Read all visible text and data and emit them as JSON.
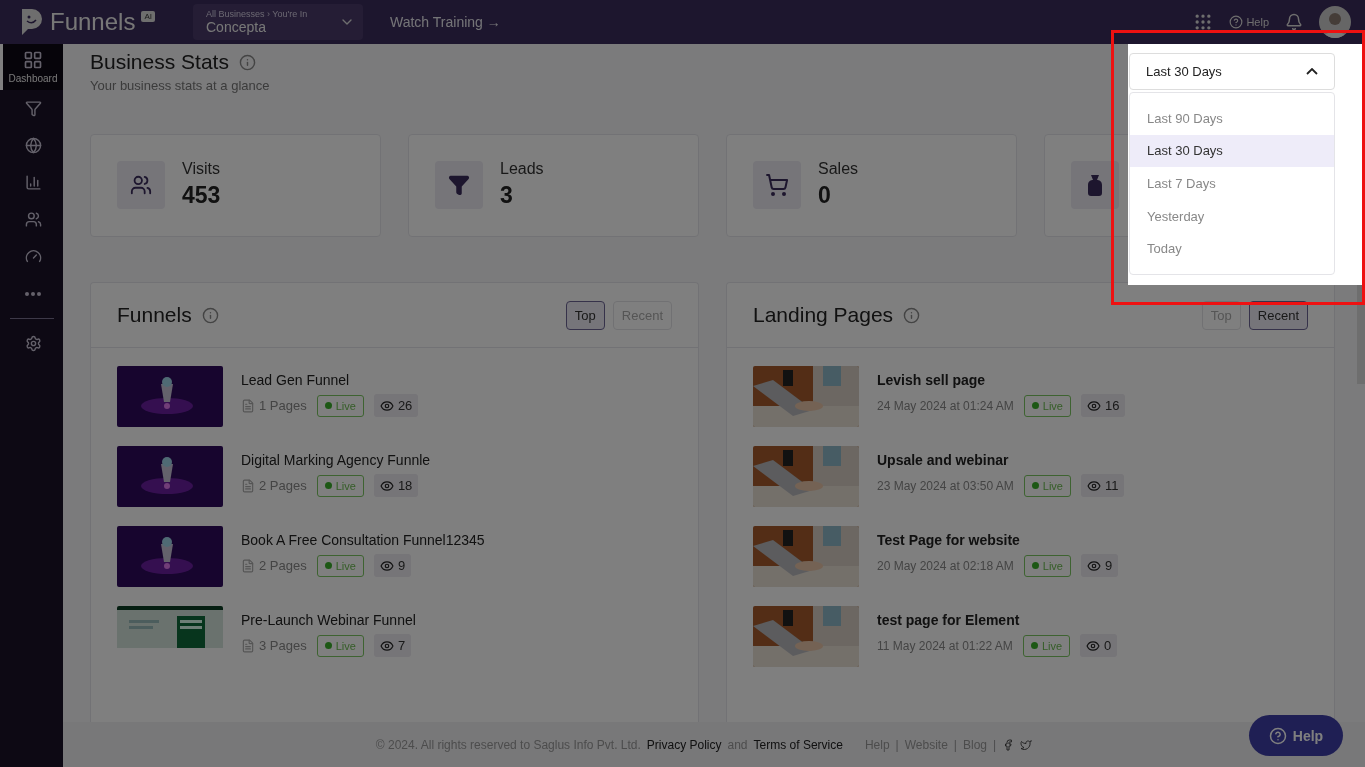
{
  "topbar": {
    "logo": "Funnels",
    "logo_badge": "AI",
    "business_label": "All Businesses › You're In",
    "business": "Concepta",
    "training_link": "Watch Training →",
    "help": "Help"
  },
  "sidebar": {
    "items": [
      {
        "kind": "dashboard",
        "label": "Dashboard",
        "selected": true
      },
      {
        "kind": "funnels",
        "selected": false
      },
      {
        "kind": "websites",
        "selected": false
      },
      {
        "kind": "analytics",
        "selected": false
      },
      {
        "kind": "contacts",
        "selected": false
      },
      {
        "kind": "performance",
        "selected": false
      },
      {
        "kind": "more",
        "selected": false
      },
      {
        "kind": "settings",
        "selected": false
      }
    ]
  },
  "header": {
    "title": "Business Stats",
    "subtitle": "Your business stats at a glance"
  },
  "stats": [
    {
      "kind": "visits",
      "label": "Visits",
      "value": "453"
    },
    {
      "kind": "leads",
      "label": "Leads",
      "value": "3"
    },
    {
      "kind": "sales",
      "label": "Sales",
      "value": "0"
    },
    {
      "kind": "revenue"
    }
  ],
  "funnels": {
    "title": "Funnels",
    "tabs": [
      {
        "label": "Top",
        "selected": true
      },
      {
        "label": "Recent",
        "selected": false
      }
    ],
    "items": [
      {
        "kind": "funnel",
        "name": "Lead Gen Funnel",
        "pages": "1 Pages",
        "status": "Live",
        "views": "26"
      },
      {
        "kind": "funnel",
        "name": "Digital Marking Agency Funnle",
        "pages": "2 Pages",
        "status": "Live",
        "views": "18"
      },
      {
        "kind": "funnel",
        "name": "Book A Free Consultation Funnel12345",
        "pages": "2 Pages",
        "status": "Live",
        "views": "9"
      },
      {
        "kind": "webpage",
        "name": "Pre-Launch Webinar Funnel",
        "pages": "3 Pages",
        "status": "Live",
        "views": "7"
      }
    ]
  },
  "landing_pages": {
    "title": "Landing Pages",
    "tabs": [
      {
        "label": "Top",
        "selected": false
      },
      {
        "label": "Recent",
        "selected": true
      }
    ],
    "items": [
      {
        "name": "Levish sell page",
        "date": "24 May 2024 at 01:24 AM",
        "status": "Live",
        "views": "16"
      },
      {
        "name": "Upsale and webinar",
        "date": "23 May 2024 at 03:50 AM",
        "status": "Live",
        "views": "11"
      },
      {
        "name": "Test Page for website",
        "date": "20 May 2024 at 02:18 AM",
        "status": "Live",
        "views": "9"
      },
      {
        "name": "test page for Element",
        "date": "11 May 2024 at 01:22 AM",
        "status": "Live",
        "views": "0"
      }
    ]
  },
  "footer": {
    "copyright": "©  2024. All rights reserved to Saglus Info Pvt. Ltd.",
    "privacy": "Privacy Policy",
    "and": "and",
    "terms": "Terms of Service",
    "links": [
      "Help",
      "Website",
      "Blog"
    ],
    "separator": "|"
  },
  "help_button": "Help",
  "date_filter": {
    "value": "Last 30 Days",
    "expanded": true,
    "options": [
      {
        "label": "Last 90 Days",
        "selected": false
      },
      {
        "label": "Last 30 Days",
        "selected": true
      },
      {
        "label": "Last 7 Days",
        "selected": false
      },
      {
        "label": "Yesterday",
        "selected": false
      },
      {
        "label": "Today",
        "selected": false
      }
    ]
  }
}
